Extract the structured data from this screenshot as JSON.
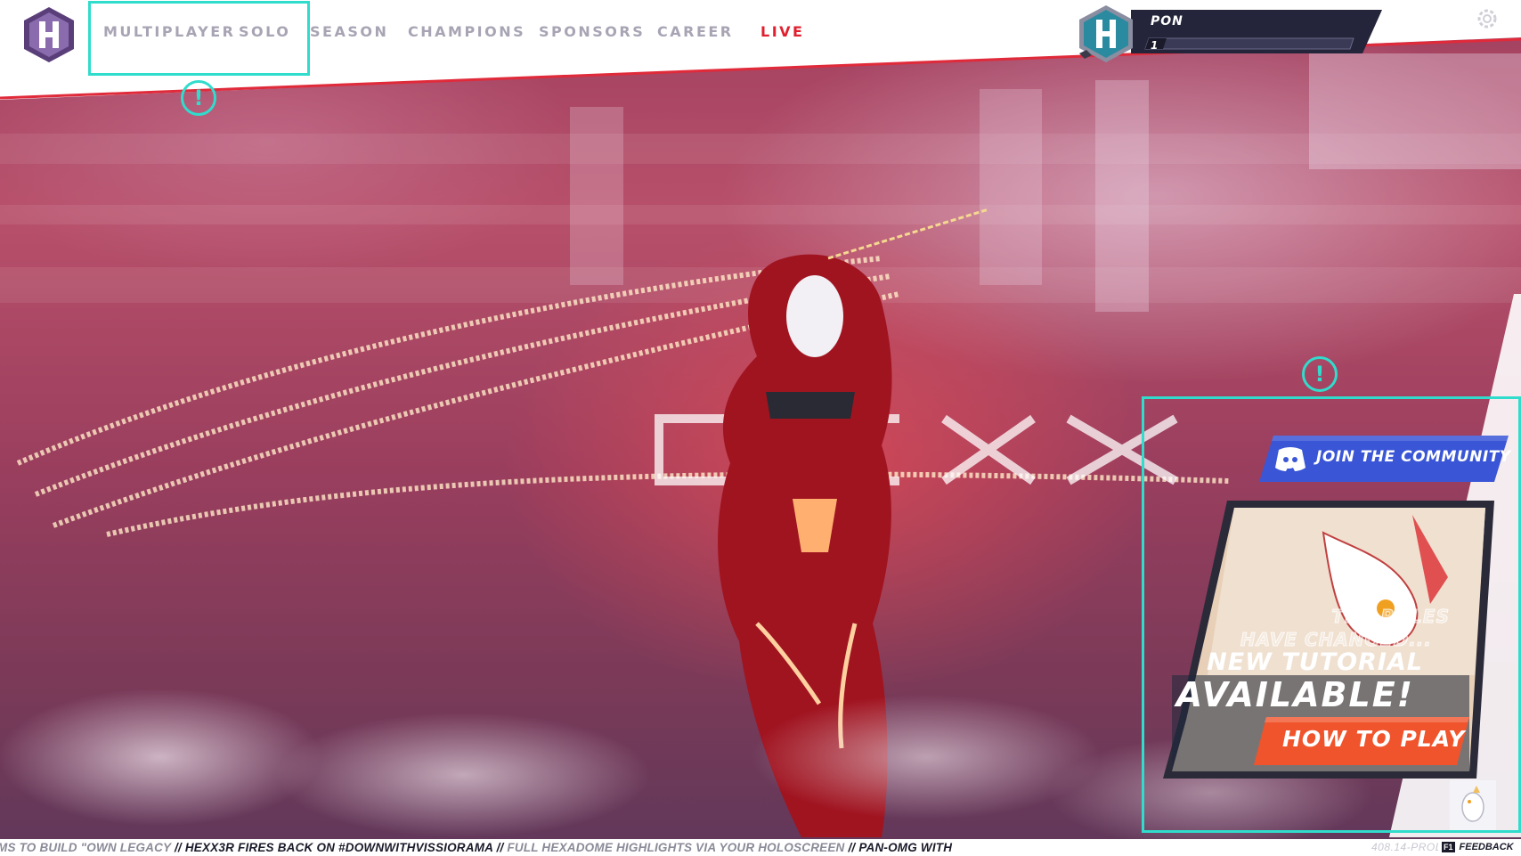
{
  "nav": {
    "items": [
      {
        "label": "MULTIPLAYER"
      },
      {
        "label": "SOLO"
      },
      {
        "label": "SEASON"
      },
      {
        "label": "CHAMPIONS"
      },
      {
        "label": "SPONSORS"
      },
      {
        "label": "CAREER"
      },
      {
        "label": "LIVE"
      }
    ],
    "logo_icon": "hexagon-h-logo-icon"
  },
  "player": {
    "name": "PON",
    "level": "1",
    "avatar_icon": "hexagon-avatar-icon"
  },
  "alerts": [
    {
      "symbol": "!"
    },
    {
      "symbol": "!"
    }
  ],
  "community": {
    "label": "JOIN THE COMMUNITY",
    "icon": "discord-icon"
  },
  "tutorial": {
    "line1": "THE RULES",
    "line2": "HAVE CHANGED...",
    "line3": "NEW TUTORIAL",
    "line4": "AVAILABLE!",
    "button_label": "HOW TO PLAY"
  },
  "ticker": {
    "segments": [
      "MS TO BUILD \"OWN LEGACY",
      "HEXX3R FIRES BACK ON #DOWNWITHVISSIORAMA",
      "FULL HEXADOME HIGHLIGHTS VIA YOUR HOLOSCREEN",
      "PAN-OMG WITH"
    ],
    "separator": "//"
  },
  "version": "408.14-PROD",
  "feedback": {
    "key": "F1",
    "label": "FEEDBACK"
  },
  "colors": {
    "highlight": "#30dccc",
    "live": "#e0202e",
    "nav_text": "#a8a4b4",
    "discord_blue": "#3a56d6",
    "howto_orange": "#f0542c",
    "player_bar": "#24243a"
  }
}
